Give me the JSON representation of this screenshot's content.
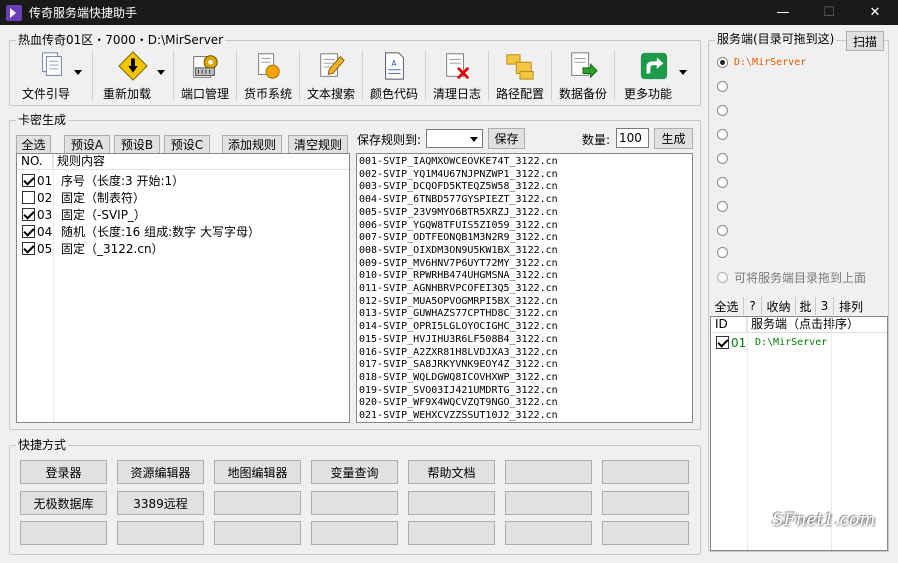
{
  "window": {
    "title": "传奇服务端快捷助手",
    "minimize": "—",
    "maximize": "☐",
    "close": "✕"
  },
  "server_info": {
    "legend": "热血传奇01区・7000・D:\\MirServer"
  },
  "toolbar": [
    {
      "label": "文件引导",
      "icon": "document-stack-icon"
    },
    {
      "label": "重新加载",
      "icon": "warning-reload-icon"
    },
    {
      "label": "端口管理",
      "icon": "port-gear-icon"
    },
    {
      "label": "货币系统",
      "icon": "currency-coin-icon"
    },
    {
      "label": "文本搜索",
      "icon": "text-search-pencil-icon"
    },
    {
      "label": "颜色代码",
      "icon": "color-code-document-icon"
    },
    {
      "label": "清理日志",
      "icon": "clear-log-icon"
    },
    {
      "label": "路径配置",
      "icon": "path-folders-icon"
    },
    {
      "label": "数据备份",
      "icon": "data-backup-icon"
    },
    {
      "label": "更多功能",
      "icon": "more-share-icon"
    }
  ],
  "card_gen": {
    "legend": "卡密生成",
    "buttons": {
      "select_all": "全选",
      "preset_a": "预设A",
      "preset_b": "预设B",
      "preset_c": "预设C",
      "add_rule": "添加规则",
      "clear_rules": "清空规则"
    },
    "headers": {
      "no": "NO.",
      "rule": "规则内容"
    },
    "rules": [
      {
        "checked": true,
        "no": "01",
        "text": "序号（长度:3  开始:1）"
      },
      {
        "checked": false,
        "no": "02",
        "text": "固定（制表符）"
      },
      {
        "checked": true,
        "no": "03",
        "text": "固定（-SVIP_）"
      },
      {
        "checked": true,
        "no": "04",
        "text": "随机（长度:16  组成:数字 大写字母）"
      },
      {
        "checked": true,
        "no": "05",
        "text": "固定（_3122.cn）"
      }
    ],
    "save_rule_label": "保存规则到:",
    "save_button": "保存",
    "count_label": "数量:",
    "count_value": "100",
    "generate_button": "生成",
    "codes": [
      "001-SVIP_IAQMXOWCEOVKE74T_3122.cn",
      "002-SVIP_YQ1M4U67NJPNZWP1_3122.cn",
      "003-SVIP_DCQOFD5KTEQZ5W58_3122.cn",
      "004-SVIP_6TNBD577GYSPIEZT_3122.cn",
      "005-SVIP_23V9MYO6BTR5XRZJ_3122.cn",
      "006-SVIP_YGQW8TFUIS5ZI059_3122.cn",
      "007-SVIP_ODTFEONQB1M3N2R9_3122.cn",
      "008-SVIP_OIXDM3ON9U5KW1BX_3122.cn",
      "009-SVIP_MV6HNV7P6UYT72MY_3122.cn",
      "010-SVIP_RPWRHB474UHGMSNA_3122.cn",
      "011-SVIP_AGNHBRVPCOFEI3Q5_3122.cn",
      "012-SVIP_MUA5OPVOGMRPI5BX_3122.cn",
      "013-SVIP_GUWHAZS77CPTHD8C_3122.cn",
      "014-SVIP_OPRI5LGLOYOCIGHC_3122.cn",
      "015-SVIP_HVJIHU3R6LF508B4_3122.cn",
      "016-SVIP_A2ZXR81H8LVDJXA3_3122.cn",
      "017-SVIP_SA8JRKYVNK9EOY4Z_3122.cn",
      "018-SVIP_WQLDGWQ8ICOVHXWP_3122.cn",
      "019-SVIP_SVO03IJ421UMDRTG_3122.cn",
      "020-SVIP_WF9X4WQCVZQT9NGO_3122.cn",
      "021-SVIP_WEHXCVZZSSUT10J2_3122.cn",
      "022-SVIP_PONMOH5DSAPASG4K_3122.cn"
    ]
  },
  "shortcuts": {
    "legend": "快捷方式",
    "row1": [
      "登录器",
      "资源编辑器",
      "地图编辑器",
      "变量查询",
      "帮助文档"
    ],
    "row2": [
      "无极数据库",
      "3389远程"
    ]
  },
  "server_panel": {
    "legend": "服务端(目录可拖到这)",
    "scan_button": "扫描",
    "selected_path": "D:\\MirServer",
    "drag_hint": "可将服务端目录拖到上面",
    "mini_toolbar": [
      "全选",
      "?",
      "收纳",
      "批",
      "3",
      "排列"
    ],
    "headers": {
      "id": "ID",
      "server": "服务端（点击排序）"
    },
    "rows": [
      {
        "checked": true,
        "id": "01",
        "path": "D:\\MirServer"
      }
    ]
  },
  "colors": {
    "accent_orange": "#e05a00",
    "accent_green": "#008000",
    "title_bg": "#1a1a1a"
  },
  "watermark": "SFnet1.com"
}
